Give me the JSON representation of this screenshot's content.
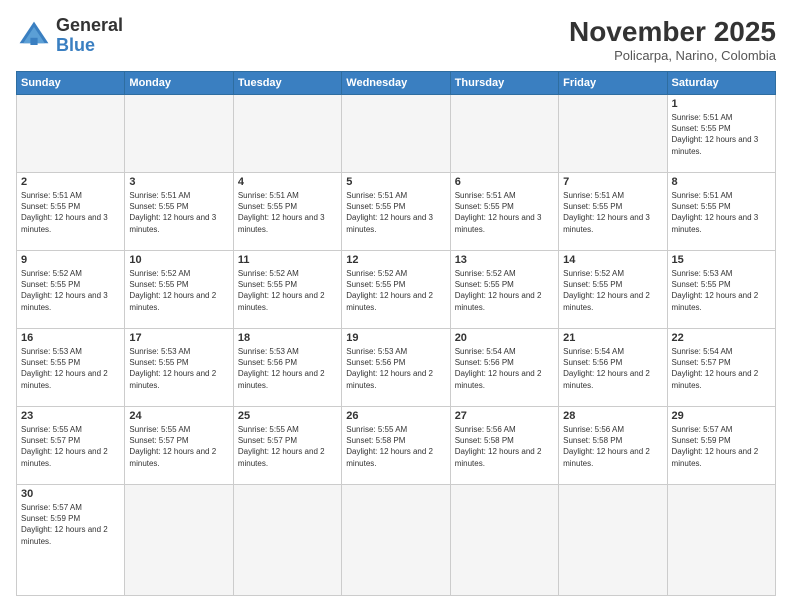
{
  "logo": {
    "text_general": "General",
    "text_blue": "Blue"
  },
  "title": "November 2025",
  "subtitle": "Policarpa, Narino, Colombia",
  "days_of_week": [
    "Sunday",
    "Monday",
    "Tuesday",
    "Wednesday",
    "Thursday",
    "Friday",
    "Saturday"
  ],
  "weeks": [
    [
      {
        "day": "",
        "info": ""
      },
      {
        "day": "",
        "info": ""
      },
      {
        "day": "",
        "info": ""
      },
      {
        "day": "",
        "info": ""
      },
      {
        "day": "",
        "info": ""
      },
      {
        "day": "",
        "info": ""
      },
      {
        "day": "1",
        "info": "Sunrise: 5:51 AM\nSunset: 5:55 PM\nDaylight: 12 hours and 3 minutes."
      }
    ],
    [
      {
        "day": "2",
        "info": "Sunrise: 5:51 AM\nSunset: 5:55 PM\nDaylight: 12 hours and 3 minutes."
      },
      {
        "day": "3",
        "info": "Sunrise: 5:51 AM\nSunset: 5:55 PM\nDaylight: 12 hours and 3 minutes."
      },
      {
        "day": "4",
        "info": "Sunrise: 5:51 AM\nSunset: 5:55 PM\nDaylight: 12 hours and 3 minutes."
      },
      {
        "day": "5",
        "info": "Sunrise: 5:51 AM\nSunset: 5:55 PM\nDaylight: 12 hours and 3 minutes."
      },
      {
        "day": "6",
        "info": "Sunrise: 5:51 AM\nSunset: 5:55 PM\nDaylight: 12 hours and 3 minutes."
      },
      {
        "day": "7",
        "info": "Sunrise: 5:51 AM\nSunset: 5:55 PM\nDaylight: 12 hours and 3 minutes."
      },
      {
        "day": "8",
        "info": "Sunrise: 5:51 AM\nSunset: 5:55 PM\nDaylight: 12 hours and 3 minutes."
      }
    ],
    [
      {
        "day": "9",
        "info": "Sunrise: 5:52 AM\nSunset: 5:55 PM\nDaylight: 12 hours and 3 minutes."
      },
      {
        "day": "10",
        "info": "Sunrise: 5:52 AM\nSunset: 5:55 PM\nDaylight: 12 hours and 2 minutes."
      },
      {
        "day": "11",
        "info": "Sunrise: 5:52 AM\nSunset: 5:55 PM\nDaylight: 12 hours and 2 minutes."
      },
      {
        "day": "12",
        "info": "Sunrise: 5:52 AM\nSunset: 5:55 PM\nDaylight: 12 hours and 2 minutes."
      },
      {
        "day": "13",
        "info": "Sunrise: 5:52 AM\nSunset: 5:55 PM\nDaylight: 12 hours and 2 minutes."
      },
      {
        "day": "14",
        "info": "Sunrise: 5:52 AM\nSunset: 5:55 PM\nDaylight: 12 hours and 2 minutes."
      },
      {
        "day": "15",
        "info": "Sunrise: 5:53 AM\nSunset: 5:55 PM\nDaylight: 12 hours and 2 minutes."
      }
    ],
    [
      {
        "day": "16",
        "info": "Sunrise: 5:53 AM\nSunset: 5:55 PM\nDaylight: 12 hours and 2 minutes."
      },
      {
        "day": "17",
        "info": "Sunrise: 5:53 AM\nSunset: 5:55 PM\nDaylight: 12 hours and 2 minutes."
      },
      {
        "day": "18",
        "info": "Sunrise: 5:53 AM\nSunset: 5:56 PM\nDaylight: 12 hours and 2 minutes."
      },
      {
        "day": "19",
        "info": "Sunrise: 5:53 AM\nSunset: 5:56 PM\nDaylight: 12 hours and 2 minutes."
      },
      {
        "day": "20",
        "info": "Sunrise: 5:54 AM\nSunset: 5:56 PM\nDaylight: 12 hours and 2 minutes."
      },
      {
        "day": "21",
        "info": "Sunrise: 5:54 AM\nSunset: 5:56 PM\nDaylight: 12 hours and 2 minutes."
      },
      {
        "day": "22",
        "info": "Sunrise: 5:54 AM\nSunset: 5:57 PM\nDaylight: 12 hours and 2 minutes."
      }
    ],
    [
      {
        "day": "23",
        "info": "Sunrise: 5:55 AM\nSunset: 5:57 PM\nDaylight: 12 hours and 2 minutes."
      },
      {
        "day": "24",
        "info": "Sunrise: 5:55 AM\nSunset: 5:57 PM\nDaylight: 12 hours and 2 minutes."
      },
      {
        "day": "25",
        "info": "Sunrise: 5:55 AM\nSunset: 5:57 PM\nDaylight: 12 hours and 2 minutes."
      },
      {
        "day": "26",
        "info": "Sunrise: 5:55 AM\nSunset: 5:58 PM\nDaylight: 12 hours and 2 minutes."
      },
      {
        "day": "27",
        "info": "Sunrise: 5:56 AM\nSunset: 5:58 PM\nDaylight: 12 hours and 2 minutes."
      },
      {
        "day": "28",
        "info": "Sunrise: 5:56 AM\nSunset: 5:58 PM\nDaylight: 12 hours and 2 minutes."
      },
      {
        "day": "29",
        "info": "Sunrise: 5:57 AM\nSunset: 5:59 PM\nDaylight: 12 hours and 2 minutes."
      }
    ],
    [
      {
        "day": "30",
        "info": "Sunrise: 5:57 AM\nSunset: 5:59 PM\nDaylight: 12 hours and 2 minutes."
      },
      {
        "day": "",
        "info": ""
      },
      {
        "day": "",
        "info": ""
      },
      {
        "day": "",
        "info": ""
      },
      {
        "day": "",
        "info": ""
      },
      {
        "day": "",
        "info": ""
      },
      {
        "day": "",
        "info": ""
      }
    ]
  ]
}
